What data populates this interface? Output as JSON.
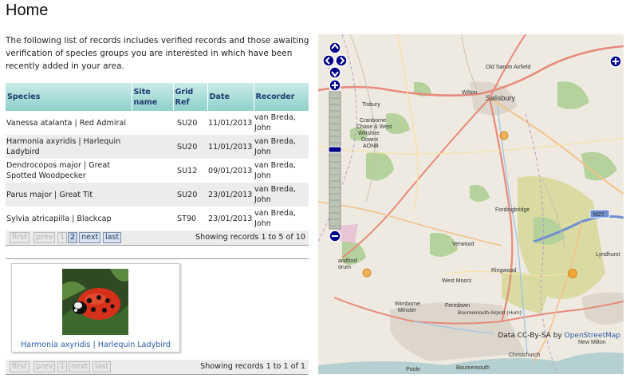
{
  "page": {
    "title": "Home",
    "intro": "The following list of records includes verified records and those awaiting verification of species groups you are interested in which have been recently added in your area."
  },
  "records_table": {
    "columns": {
      "species": "Species",
      "site_name": "Site name",
      "grid_ref": "Grid Ref",
      "date": "Date",
      "recorder": "Recorder"
    },
    "rows": [
      {
        "species": "Vanessa atalanta | Red Admiral",
        "site_name": "",
        "grid_ref": "SU20",
        "date": "11/01/2013",
        "recorder": "van Breda, John"
      },
      {
        "species": "Harmonia axyridis | Harlequin Ladybird",
        "site_name": "",
        "grid_ref": "SU20",
        "date": "11/01/2013",
        "recorder": "van Breda, John"
      },
      {
        "species": "Dendrocopos major | Great Spotted Woodpecker",
        "site_name": "",
        "grid_ref": "SU12",
        "date": "09/01/2013",
        "recorder": "van Breda, John"
      },
      {
        "species": "Parus major | Great Tit",
        "site_name": "",
        "grid_ref": "SU20",
        "date": "23/01/2013",
        "recorder": "van Breda, John"
      },
      {
        "species": "Sylvia atricapilla | Blackcap",
        "site_name": "",
        "grid_ref": "ST90",
        "date": "23/01/2013",
        "recorder": "van Breda, John"
      }
    ],
    "pager": {
      "first": "first",
      "prev": "prev",
      "page1": "1",
      "page2": "2",
      "next": "next",
      "last": "last",
      "status": "Showing records 1 to 5 of 10"
    }
  },
  "photos": {
    "items": [
      {
        "caption": "Harmonia axyridis | Harlequin Ladybird",
        "icon": "ladybird-photo"
      }
    ],
    "pager": {
      "first": "first",
      "prev": "prev",
      "page1": "1",
      "next": "next",
      "last": "last",
      "status": "Showing records 1 to 1 of 1"
    }
  },
  "map": {
    "attribution_prefix": "Data CC-By-SA by",
    "attribution_link": "OpenStreetMap",
    "labels": {
      "old_sarum": "Old Sarum Airfield",
      "wilton": "Wilton",
      "salisbury": "Salisbury",
      "tisbury": "Tisbury",
      "cranborne": "Cranborne Chase & West Wiltshire Downs AONB",
      "fordingbridge": "Fordingbridge",
      "m27": "M27",
      "verwood": "Verwood",
      "ringwood": "Ringwood",
      "lyndhurst": "Lyndhurst",
      "west_moors": "West Moors",
      "wimborne": "Wimborne Minster",
      "ferndown": "Ferndown",
      "bournemouth_airport": "Bournemouth Airport (Hurn)",
      "new_milton": "New Milton",
      "christchurch": "Christchurch",
      "poole": "Poole",
      "bournemouth": "Bournemouth",
      "blandford": "andford orum"
    },
    "colors": {
      "marker": "#f0a030",
      "control": "#00008b",
      "woodland": "#b5d29c",
      "heath": "#d6d99b"
    }
  }
}
